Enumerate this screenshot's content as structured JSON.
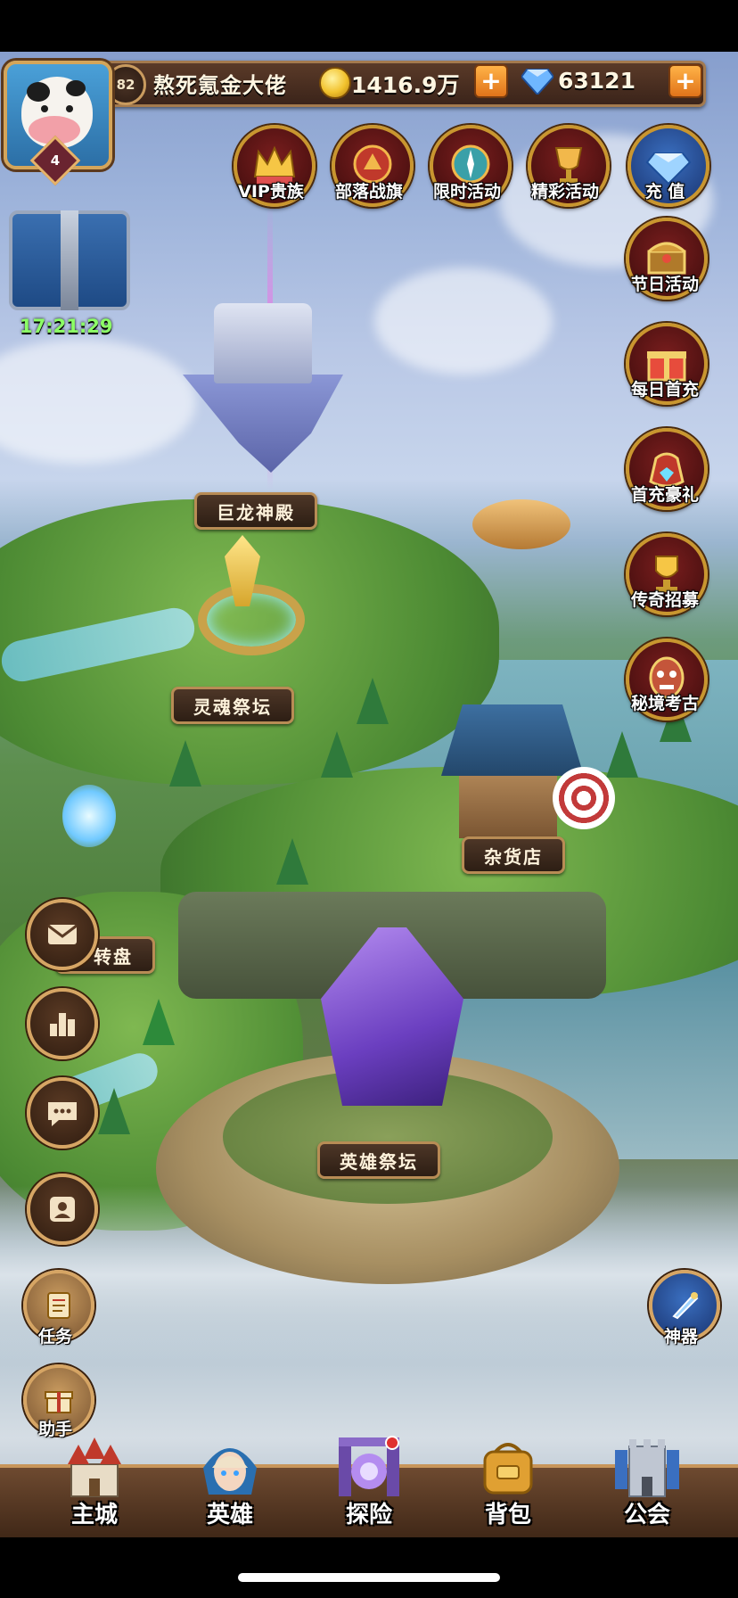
{
  "player": {
    "level": "82",
    "name": "熬死氪金大佬",
    "avatar_badge": "4",
    "gold": "1416.9万",
    "diamonds": "63121"
  },
  "chest": {
    "timer": "17:21:29"
  },
  "top_features": [
    {
      "label": "VIP贵族",
      "icon": "crown-icon"
    },
    {
      "label": "部落战旗",
      "icon": "war-banner-icon"
    },
    {
      "label": "限时活动",
      "icon": "compass-icon"
    },
    {
      "label": "精彩活动",
      "icon": "goblet-icon"
    },
    {
      "label": "充 值",
      "icon": "diamond-icon"
    }
  ],
  "right_features": [
    {
      "label": "节日活动",
      "icon": "treasure-chest-icon"
    },
    {
      "label": "每日首充",
      "icon": "gift-box-icon"
    },
    {
      "label": "首充豪礼",
      "icon": "gem-pouch-icon"
    },
    {
      "label": "传奇招募",
      "icon": "trophy-icon"
    },
    {
      "label": "秘境考古",
      "icon": "tribal-mask-icon"
    }
  ],
  "places": {
    "dragon_temple": "巨龙神殿",
    "soul_altar": "灵魂祭坛",
    "general_store": "杂货店",
    "wheel": "转盘",
    "hero_altar": "英雄祭坛"
  },
  "side_buttons": {
    "mail": "mail-icon",
    "ranking": "ranking-icon",
    "chat": "chat-icon",
    "friends": "friends-icon",
    "tasks": "任务",
    "helper": "助手",
    "artifact": "神器"
  },
  "nav": [
    {
      "label": "主城",
      "icon": "castle-icon"
    },
    {
      "label": "英雄",
      "icon": "hero-portrait-icon"
    },
    {
      "label": "探险",
      "icon": "portal-icon"
    },
    {
      "label": "背包",
      "icon": "backpack-icon"
    },
    {
      "label": "公会",
      "icon": "guild-tower-icon"
    }
  ],
  "colors": {
    "accent_gold": "#c9962f",
    "panel_brown": "#3b241a",
    "timer_green": "#8cff66"
  }
}
